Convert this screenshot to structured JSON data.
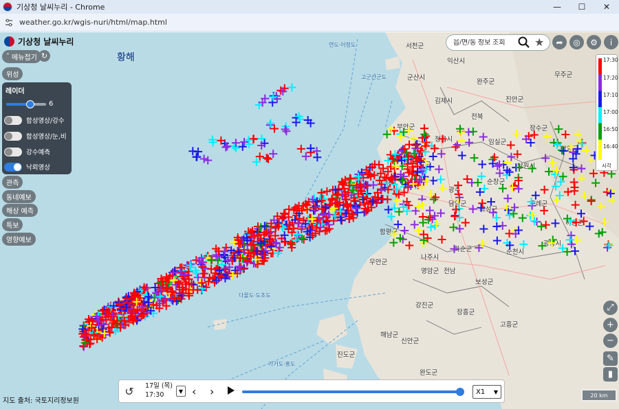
{
  "window": {
    "title": "기상청 날씨누리 - Chrome",
    "url": "weather.go.kr/wgis-nuri/html/map.html",
    "minimize_icon": "minimize-icon",
    "maximize_icon": "maximize-icon",
    "close_icon": "close-icon"
  },
  "header": {
    "logo_text": "기상청 날씨누리"
  },
  "menu": {
    "collapse_label": "메뉴접기",
    "categories": [
      "위성",
      "관측",
      "동네예보",
      "해상 예측",
      "특보",
      "영향예보"
    ]
  },
  "radar_panel": {
    "title": "레이더",
    "opacity_value": "6",
    "opacity_level": 0.6,
    "toggles": [
      {
        "label": "합성영상/강수",
        "on": false
      },
      {
        "label": "합성영상/눈,비",
        "on": false
      },
      {
        "label": "강수예측",
        "on": false
      },
      {
        "label": "낙뢰영상",
        "on": true
      }
    ]
  },
  "search": {
    "placeholder": "읍/면/동 정보 조회"
  },
  "legend": {
    "labels": [
      "17:30",
      "17:20",
      "17:10",
      "17:00",
      "16:50",
      "16:40",
      "시각"
    ],
    "colors": [
      "#ff0000",
      "#8a2be2",
      "#1a1ae6",
      "#00f0ff",
      "#00a000",
      "#ffff00"
    ]
  },
  "map_labels": [
    "황해",
    "서천군",
    "익산시",
    "군산시",
    "완주군",
    "무주군",
    "김제시",
    "진안군",
    "전북",
    "부안군",
    "정읍시",
    "임실군",
    "장수군",
    "함양군",
    "고창군",
    "순창군",
    "남원시",
    "광주",
    "담양군",
    "곡성군",
    "구례군",
    "하동군",
    "함평군",
    "화순군",
    "광양시",
    "무안군",
    "나주시",
    "전남",
    "순천시",
    "영암군",
    "보성군",
    "강진군",
    "장흥군",
    "해남군",
    "고흥군",
    "진도군",
    "신안군",
    "완도군",
    "연도·어청도",
    "고군산군도",
    "다물도·도초도",
    "가거도·홍도"
  ],
  "timeline": {
    "date": "17일 (목)",
    "time": "17:30",
    "progress": 1.0,
    "speed": "X1"
  },
  "footer": {
    "source": "지도 출처: 국토지리정보원",
    "scale": "20 km"
  }
}
